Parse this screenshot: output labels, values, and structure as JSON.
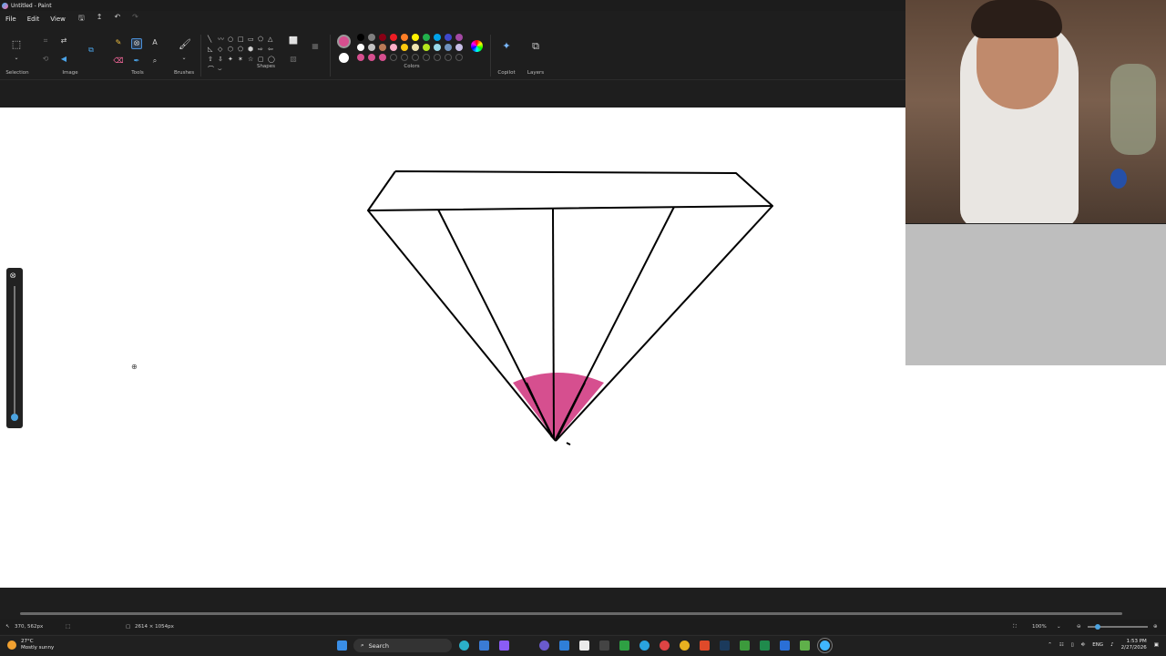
{
  "window": {
    "title": "Untitled - Paint"
  },
  "menu": {
    "file": "File",
    "edit": "Edit",
    "view": "View"
  },
  "quick_access": {
    "save_icon": "save-icon",
    "share_icon": "share-icon",
    "undo_icon": "undo-icon",
    "redo_icon": "redo-icon"
  },
  "ribbon": {
    "selection_label": "Selection",
    "image_label": "Image",
    "tools_label": "Tools",
    "brushes_label": "Brushes",
    "shapes_label": "Shapes",
    "colors_label": "Colors",
    "copilot_label": "Copilot",
    "layers_label": "Layers",
    "text_tool": "A",
    "shape_glyphs": [
      "╲",
      "〰",
      "○",
      "□",
      "▭",
      "⬠",
      "△",
      "◺",
      "◇",
      "⬡",
      "⬠",
      "⬢",
      "⇨",
      "⇦",
      "⇧",
      "⇩",
      "✦",
      "✶",
      "☆",
      "▢",
      "◯",
      "⌒",
      "⌣"
    ]
  },
  "colors": {
    "current_primary": "#d64f8f",
    "current_secondary": "#ffffff",
    "palette_row1": [
      "#000000",
      "#7f7f7f",
      "#880015",
      "#ed1c24",
      "#ff7f27",
      "#fff200",
      "#22b14c",
      "#00a2e8",
      "#3f48cc",
      "#a349a4"
    ],
    "palette_row2": [
      "#ffffff",
      "#c3c3c3",
      "#b97a57",
      "#ffaec9",
      "#ffc90e",
      "#efe4b0",
      "#b5e61d",
      "#99d9ea",
      "#7092be",
      "#c8bfe7"
    ],
    "palette_row3": [
      "#d64f8f",
      "#d64f8f",
      "#d64f8f",
      "",
      "",
      "",
      "",
      "",
      "",
      ""
    ]
  },
  "status": {
    "cursor_position": "370, 562px",
    "canvas_size": "2614 × 1054px",
    "zoom": "100%"
  },
  "taskbar": {
    "temperature": "27°C",
    "weather_text": "Mostly sunny",
    "search_placeholder": "Search",
    "language": "ENG",
    "time": "1:53 PM",
    "date": "2/27/2026"
  },
  "drawing": {
    "fill_color": "#d64f8f",
    "stroke_color": "#000000"
  }
}
